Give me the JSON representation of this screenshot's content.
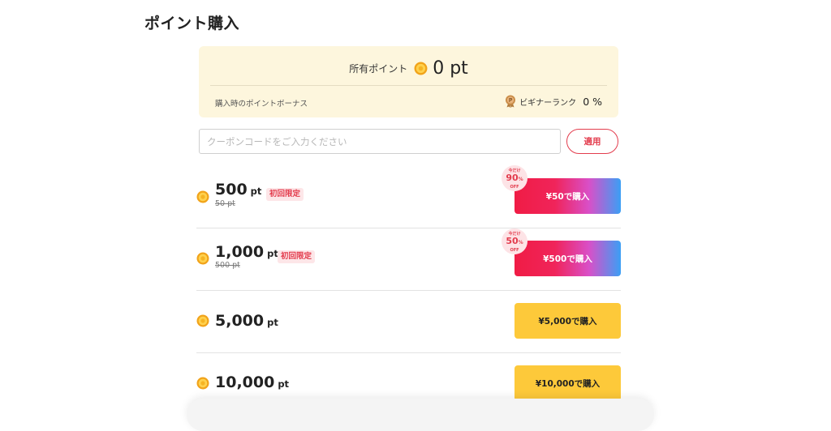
{
  "page": {
    "title": "ポイント購入"
  },
  "points_card": {
    "owned_label": "所有ポイント",
    "owned_value": "0 pt",
    "bonus_label": "購入時のポイントボーナス",
    "rank_label": "ビギナーランク",
    "rank_percent": "0 %"
  },
  "coupon": {
    "placeholder": "クーポンコードをご入力ください",
    "apply_label": "適用"
  },
  "packages": [
    {
      "amount": "500",
      "unit": "pt",
      "original": "50 pt",
      "badge": "初回限定",
      "discount_small": "今だけ",
      "discount_number": "90",
      "discount_percent": "%",
      "discount_off": "OFF",
      "button_label": "¥50で購入"
    },
    {
      "amount": "1,000",
      "unit": "pt",
      "original": "500 pt",
      "badge": "初回限定",
      "discount_small": "今だけ",
      "discount_number": "50",
      "discount_percent": "%",
      "discount_off": "OFF",
      "button_label": "¥500で購入"
    },
    {
      "amount": "5,000",
      "unit": "pt",
      "button_label": "¥5,000で購入"
    },
    {
      "amount": "10,000",
      "unit": "pt",
      "button_label": "¥10,000で購入"
    }
  ],
  "colors": {
    "accent_red": "#e33c4d",
    "buy_yellow": "#fdc93a",
    "card_background": "#fdf6dd",
    "gradient_start": "#f01c45",
    "gradient_end": "#3b9ff5"
  },
  "icons": {
    "coin": "coin-icon",
    "rank": "rank-medal-icon"
  }
}
